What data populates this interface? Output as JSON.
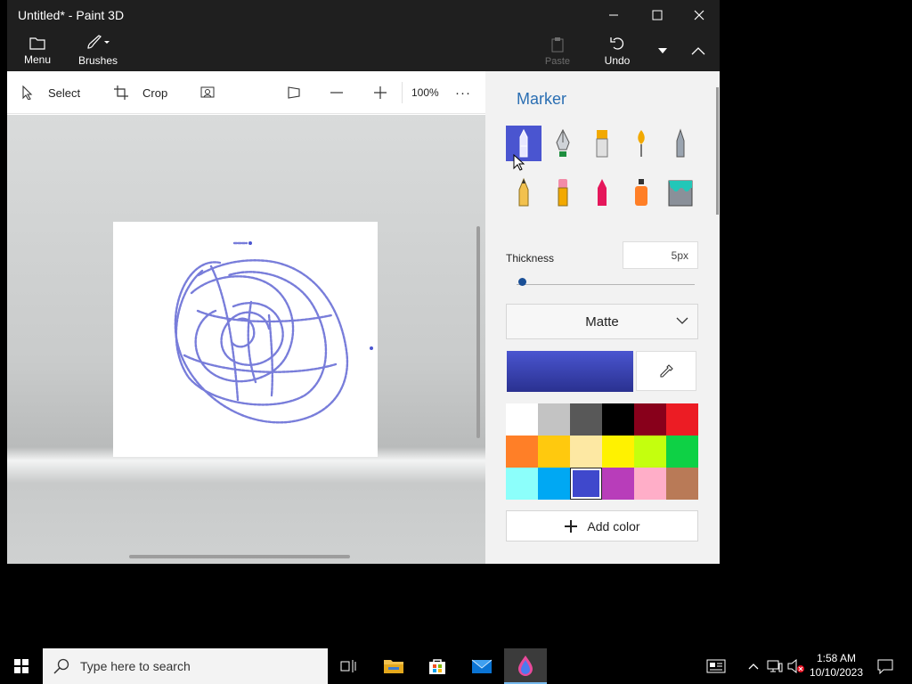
{
  "window": {
    "title": "Untitled* - Paint 3D"
  },
  "ribbon": {
    "menu": "Menu",
    "brushes": "Brushes",
    "paste": "Paste",
    "undo": "Undo"
  },
  "toolbar": {
    "select": "Select",
    "crop": "Crop",
    "zoom": "100%",
    "more": "···"
  },
  "panel": {
    "title": "Marker",
    "brushes": [
      "marker-icon",
      "calligraphy-pen-icon",
      "oil-brush-icon",
      "watercolor-icon",
      "pixel-pen-icon",
      "pencil-icon",
      "eraser-icon",
      "crayon-icon",
      "spray-can-icon",
      "fill-icon"
    ],
    "selected_brush": "marker-icon",
    "thickness_label": "Thickness",
    "thickness_value": "5px",
    "thickness_fraction": 0.03,
    "finish": "Matte",
    "current_color": "#4a55d0",
    "palette": [
      "#ffffff",
      "#c3c3c3",
      "#585858",
      "#000000",
      "#88001b",
      "#ec1c24",
      "#ff7f27",
      "#ffc90e",
      "#fde8a3",
      "#fff200",
      "#c4ff0e",
      "#0ed145",
      "#8cfffb",
      "#00a8f3",
      "#3f48cc",
      "#b83dba",
      "#ffaec8",
      "#b97a57"
    ],
    "selected_swatch": 14,
    "add_color": "Add color"
  },
  "taskbar": {
    "search_placeholder": "Type here to search",
    "time": "1:58 AM",
    "date": "10/10/2023"
  }
}
